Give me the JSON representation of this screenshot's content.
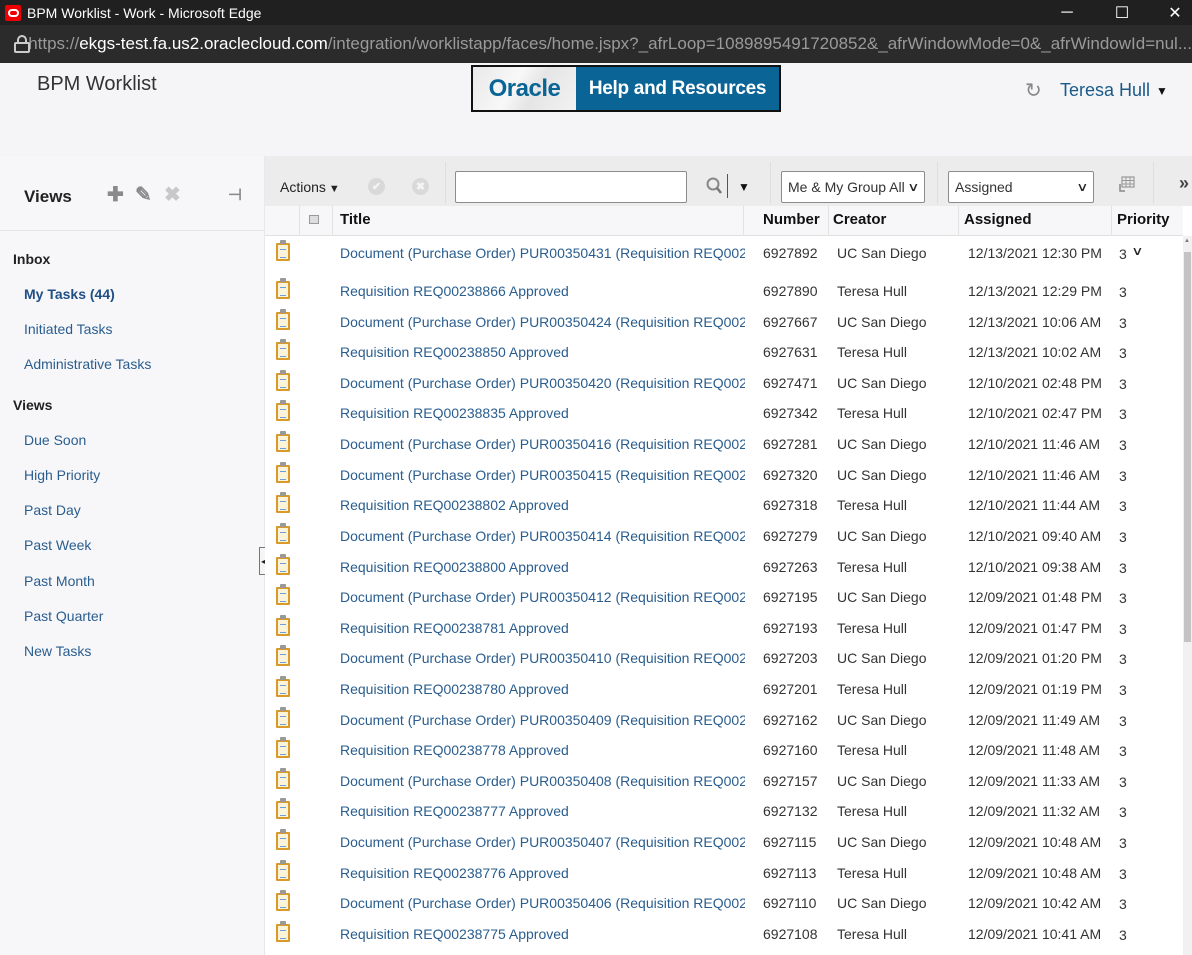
{
  "window": {
    "title": "BPM Worklist - Work - Microsoft Edge",
    "url_scheme": "https://",
    "url_host": "ekgs-test.fa.us2.oraclecloud.com",
    "url_path": "/integration/worklistapp/faces/home.jspx?_afrLoop=1089895491720852&_afrWindowMode=0&_afrWindowId=nul...",
    "controls": {
      "minimize": "─",
      "maximize": "☐",
      "close": "✕"
    }
  },
  "header": {
    "app_title": "BPM Worklist",
    "banner_left": "Oracle",
    "banner_right": "Help and Resources",
    "refresh_icon": "↻",
    "user_name": "Teresa Hull",
    "user_caret": "▼"
  },
  "sidebar": {
    "title": "Views",
    "tools": {
      "add": "✚",
      "edit": "✎",
      "delete": "✖",
      "pin": "⊣"
    },
    "inbox_label": "Inbox",
    "inbox_items": [
      {
        "label": "My Tasks (44)",
        "active": true
      },
      {
        "label": "Initiated Tasks"
      },
      {
        "label": "Administrative Tasks"
      }
    ],
    "views_label": "Views",
    "view_items": [
      {
        "label": "Due Soon"
      },
      {
        "label": "High Priority"
      },
      {
        "label": "Past Day"
      },
      {
        "label": "Past Week"
      },
      {
        "label": "Past Month"
      },
      {
        "label": "Past Quarter"
      },
      {
        "label": "New Tasks"
      }
    ],
    "splitter_glyph": "◂"
  },
  "toolbar": {
    "actions_label": "Actions",
    "actions_caret": "▼",
    "approve_glyph": "✔",
    "reject_glyph": "✖",
    "search_value": "",
    "search_placeholder": "",
    "search_caret": "▼",
    "assignee_filter": "Me & My Group All",
    "state_filter": "Assigned",
    "chevron": "∨",
    "overflow": "»"
  },
  "table": {
    "columns": {
      "title": "Title",
      "number": "Number",
      "creator": "Creator",
      "assigned": "Assigned",
      "priority": "Priority"
    },
    "rows": [
      {
        "title": "Document (Purchase Order) PUR00350431 (Requisition REQ002",
        "number": "6927892",
        "creator": "UC San Diego",
        "assigned": "12/13/2021 12:30 PM",
        "priority": "3"
      },
      {
        "title": "Requisition REQ00238866 Approved",
        "number": "6927890",
        "creator": "Teresa Hull",
        "assigned": "12/13/2021 12:29 PM",
        "priority": "3"
      },
      {
        "title": "Document (Purchase Order) PUR00350424 (Requisition REQ002",
        "number": "6927667",
        "creator": "UC San Diego",
        "assigned": "12/13/2021 10:06 AM",
        "priority": "3"
      },
      {
        "title": "Requisition REQ00238850 Approved",
        "number": "6927631",
        "creator": "Teresa Hull",
        "assigned": "12/13/2021 10:02 AM",
        "priority": "3"
      },
      {
        "title": "Document (Purchase Order) PUR00350420 (Requisition REQ002",
        "number": "6927471",
        "creator": "UC San Diego",
        "assigned": "12/10/2021 02:48 PM",
        "priority": "3"
      },
      {
        "title": "Requisition REQ00238835 Approved",
        "number": "6927342",
        "creator": "Teresa Hull",
        "assigned": "12/10/2021 02:47 PM",
        "priority": "3"
      },
      {
        "title": "Document (Purchase Order) PUR00350416 (Requisition REQ002",
        "number": "6927281",
        "creator": "UC San Diego",
        "assigned": "12/10/2021 11:46 AM",
        "priority": "3"
      },
      {
        "title": "Document (Purchase Order) PUR00350415 (Requisition REQ002",
        "number": "6927320",
        "creator": "UC San Diego",
        "assigned": "12/10/2021 11:46 AM",
        "priority": "3"
      },
      {
        "title": "Requisition REQ00238802 Approved",
        "number": "6927318",
        "creator": "Teresa Hull",
        "assigned": "12/10/2021 11:44 AM",
        "priority": "3"
      },
      {
        "title": "Document (Purchase Order) PUR00350414 (Requisition REQ002",
        "number": "6927279",
        "creator": "UC San Diego",
        "assigned": "12/10/2021 09:40 AM",
        "priority": "3"
      },
      {
        "title": "Requisition REQ00238800 Approved",
        "number": "6927263",
        "creator": "Teresa Hull",
        "assigned": "12/10/2021 09:38 AM",
        "priority": "3"
      },
      {
        "title": "Document (Purchase Order) PUR00350412 (Requisition REQ002",
        "number": "6927195",
        "creator": "UC San Diego",
        "assigned": "12/09/2021 01:48 PM",
        "priority": "3"
      },
      {
        "title": "Requisition REQ00238781 Approved",
        "number": "6927193",
        "creator": "Teresa Hull",
        "assigned": "12/09/2021 01:47 PM",
        "priority": "3"
      },
      {
        "title": "Document (Purchase Order) PUR00350410 (Requisition REQ002",
        "number": "6927203",
        "creator": "UC San Diego",
        "assigned": "12/09/2021 01:20 PM",
        "priority": "3"
      },
      {
        "title": "Requisition REQ00238780 Approved",
        "number": "6927201",
        "creator": "Teresa Hull",
        "assigned": "12/09/2021 01:19 PM",
        "priority": "3"
      },
      {
        "title": "Document (Purchase Order) PUR00350409 (Requisition REQ002",
        "number": "6927162",
        "creator": "UC San Diego",
        "assigned": "12/09/2021 11:49 AM",
        "priority": "3"
      },
      {
        "title": "Requisition REQ00238778 Approved",
        "number": "6927160",
        "creator": "Teresa Hull",
        "assigned": "12/09/2021 11:48 AM",
        "priority": "3"
      },
      {
        "title": "Document (Purchase Order) PUR00350408 (Requisition REQ002",
        "number": "6927157",
        "creator": "UC San Diego",
        "assigned": "12/09/2021 11:33 AM",
        "priority": "3"
      },
      {
        "title": "Requisition REQ00238777 Approved",
        "number": "6927132",
        "creator": "Teresa Hull",
        "assigned": "12/09/2021 11:32 AM",
        "priority": "3"
      },
      {
        "title": "Document (Purchase Order) PUR00350407 (Requisition REQ002",
        "number": "6927115",
        "creator": "UC San Diego",
        "assigned": "12/09/2021 10:48 AM",
        "priority": "3"
      },
      {
        "title": "Requisition REQ00238776 Approved",
        "number": "6927113",
        "creator": "Teresa Hull",
        "assigned": "12/09/2021 10:48 AM",
        "priority": "3"
      },
      {
        "title": "Document (Purchase Order) PUR00350406 (Requisition REQ002",
        "number": "6927110",
        "creator": "UC San Diego",
        "assigned": "12/09/2021 10:42 AM",
        "priority": "3"
      },
      {
        "title": "Requisition REQ00238775 Approved",
        "number": "6927108",
        "creator": "Teresa Hull",
        "assigned": "12/09/2021 10:41 AM",
        "priority": "3"
      }
    ]
  }
}
